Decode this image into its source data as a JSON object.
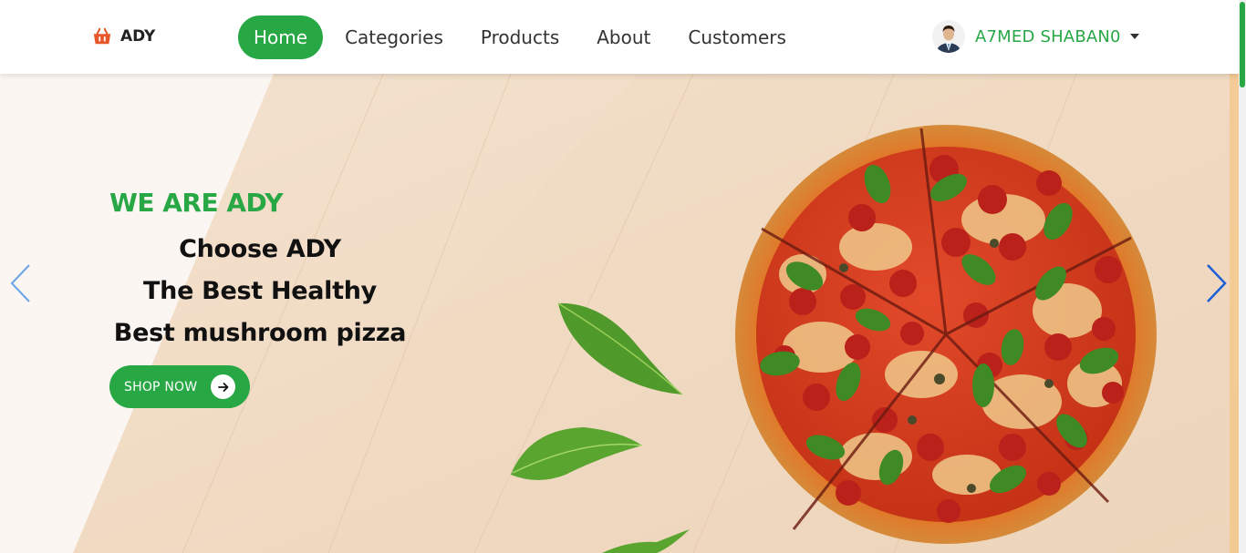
{
  "brand": {
    "name": "ADY",
    "icon": "basket-icon",
    "color": "#e8572a"
  },
  "nav": {
    "items": [
      {
        "label": "Home",
        "active": true
      },
      {
        "label": "Categories",
        "active": false
      },
      {
        "label": "Products",
        "active": false
      },
      {
        "label": "About",
        "active": false
      },
      {
        "label": "Customers",
        "active": false
      }
    ]
  },
  "user": {
    "name": "A7MED SHABAN0",
    "dropdown_icon": "caret-down-icon"
  },
  "hero": {
    "tagline": "WE ARE ADY",
    "lines": [
      "Choose ADY",
      "The Best Healthy",
      "Best mushroom pizza"
    ],
    "cta_label": "SHOP NOW",
    "cta_icon": "arrow-right-icon",
    "prev_icon": "chevron-left-icon",
    "next_icon": "chevron-right-icon"
  },
  "colors": {
    "accent": "#28a745",
    "text_dark": "#111111",
    "carousel_arrow": "#1e5fd6"
  }
}
